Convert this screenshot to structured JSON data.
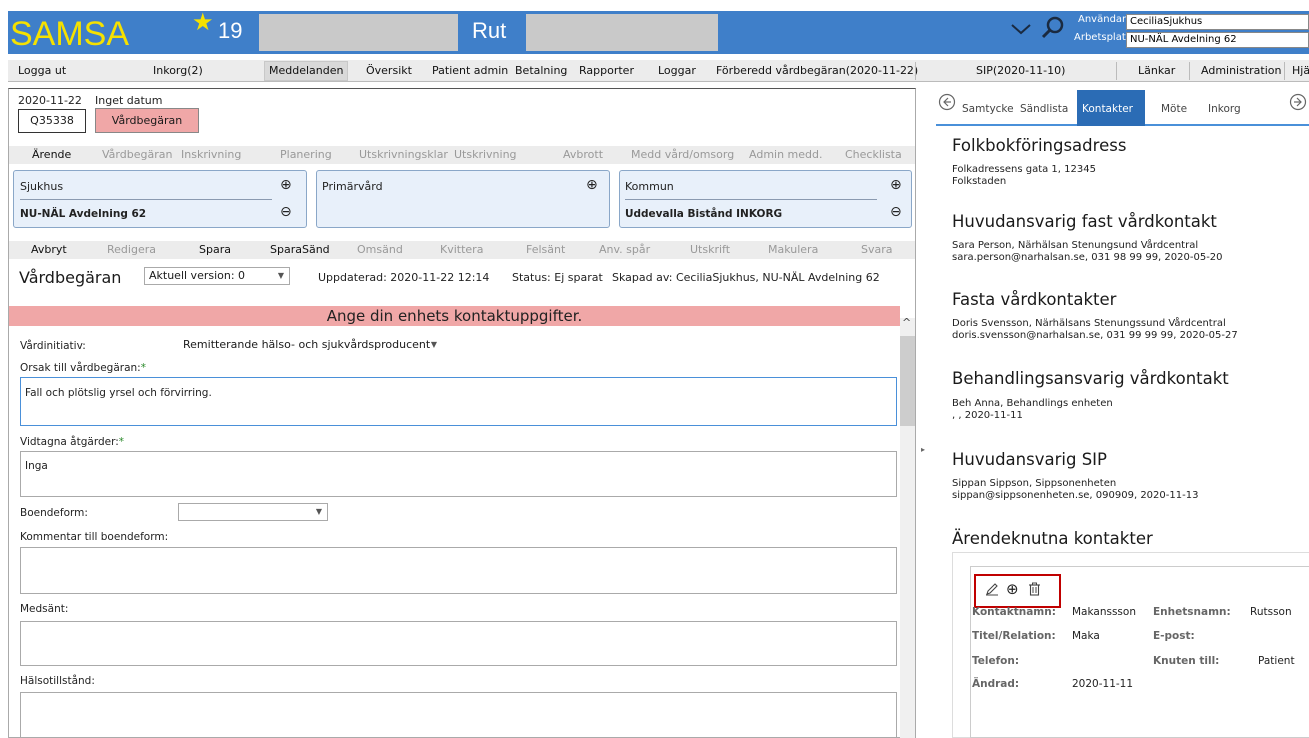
{
  "header": {
    "logo": "SAMSA",
    "patient_number": "19",
    "patient_name": "Rut",
    "user_label": "Användare:",
    "user_value": "CeciliaSjukhus",
    "workplace_label": "Arbetsplats:",
    "workplace_value": "NU-NÄL Avdelning 62",
    "colors": {
      "bar": "#3f7fc9",
      "logo": "#f5e100"
    }
  },
  "menu": {
    "items": [
      "Logga ut",
      "Inkorg(2)",
      "Meddelanden",
      "Översikt",
      "Patient admin",
      "Betalning",
      "Rapporter",
      "Loggar",
      "Förberedd vårdbegäran(2020-11-22)",
      "SIP(2020-11-10)",
      "Länkar",
      "Administration",
      "Hjä"
    ],
    "active": "Meddelanden"
  },
  "left": {
    "date1": "2020-11-22",
    "date2_label": "Inget datum",
    "case_id": "Q35338",
    "doc_chip": "Vårdbegäran",
    "workflow_tabs": [
      "Ärende",
      "Vårdbegäran",
      "Inskrivning",
      "Planering",
      "Utskrivningsklar",
      "Utskrivning",
      "Avbrott",
      "Medd vård/omsorg",
      "Admin medd.",
      "Checklista"
    ],
    "orgs": {
      "sjukhus": {
        "title": "Sjukhus",
        "value": "NU-NÄL Avdelning 62"
      },
      "primarvard": {
        "title": "Primärvård"
      },
      "kommun": {
        "title": "Kommun",
        "value": "Uddevalla Bistånd INKORG"
      }
    },
    "actions": [
      "Avbryt",
      "Redigera",
      "Spara",
      "SparaSänd",
      "Omsänd",
      "Kvittera",
      "Felsänt",
      "Anv. spår",
      "Utskrift",
      "Makulera",
      "Svara"
    ],
    "form_title": "Vårdbegäran",
    "version": "Aktuell version: 0",
    "updated": "Uppdaterad: 2020-11-22 12:14",
    "status": "Status: Ej sparat",
    "created_by": "Skapad av: CeciliaSjukhus, NU-NÄL Avdelning 62",
    "banner": "Ange din enhets kontaktuppgifter.",
    "fields": {
      "vardinitiativ_label": "Vårdinitiativ:",
      "vardinitiativ_value": "Remitterande hälso- och sjukvårdsproducent",
      "orsak_label": "Orsak till vårdbegäran:",
      "orsak_value": "Fall och plötslig yrsel och förvirring.",
      "vidtagna_label": "Vidtagna åtgärder:",
      "vidtagna_value": "Inga",
      "boendeform_label": "Boendeform:",
      "boendeform_value": "",
      "kommentar_label": "Kommentar till boendeform:",
      "medsant_label": "Medsänt:",
      "halsotillstand_label": "Hälsotillstånd:",
      "required_mark": "*"
    }
  },
  "right": {
    "tabs": [
      "Samtycke",
      "Sändlista",
      "Kontakter",
      "Möte",
      "Inkorg"
    ],
    "active_tab": "Kontakter",
    "sections": {
      "folkbok_title": "Folkbokföringsadress",
      "folkbok_line1": "Folkadressens gata 1, 12345",
      "folkbok_line2": "Folkstaden",
      "huvudfast_title": "Huvudansvarig fast vårdkontakt",
      "huvudfast_line1": "Sara Person, Närhälsan Stenungsund Vårdcentral",
      "huvudfast_line2": "sara.person@narhalsan.se, 031 98 99 99, 2020-05-20",
      "fasta_title": "Fasta vårdkontakter",
      "fasta_line1": "Doris Svensson, Närhälsans Stenungssund Vårdcentral",
      "fasta_line2": "doris.svensson@narhalsan.se, 031 99 99 99, 2020-05-27",
      "behand_title": "Behandlingsansvarig vårdkontakt",
      "behand_line1": "Beh Anna, Behandlings enheten",
      "behand_line2": ", , 2020-11-11",
      "sip_title": "Huvudansvarig SIP",
      "sip_line1": "Sippan Sippson, Sippsonenheten",
      "sip_line2": "sippan@sippsonenheten.se, 090909, 2020-11-13",
      "arende_title": "Ärendeknutna kontakter"
    },
    "contact_card": {
      "kontaktnamn_label": "Kontaktnamn:",
      "kontaktnamn_value": "Makanssson",
      "enhetsnamn_label": "Enhetsnamn:",
      "enhetsnamn_value": "Rutsson",
      "titel_label": "Titel/Relation:",
      "titel_value": "Maka",
      "epost_label": "E-post:",
      "telefon_label": "Telefon:",
      "knuten_label": "Knuten till:",
      "knuten_value": "Patient",
      "andrad_label": "Ändrad:",
      "andrad_value": "2020-11-11"
    }
  }
}
